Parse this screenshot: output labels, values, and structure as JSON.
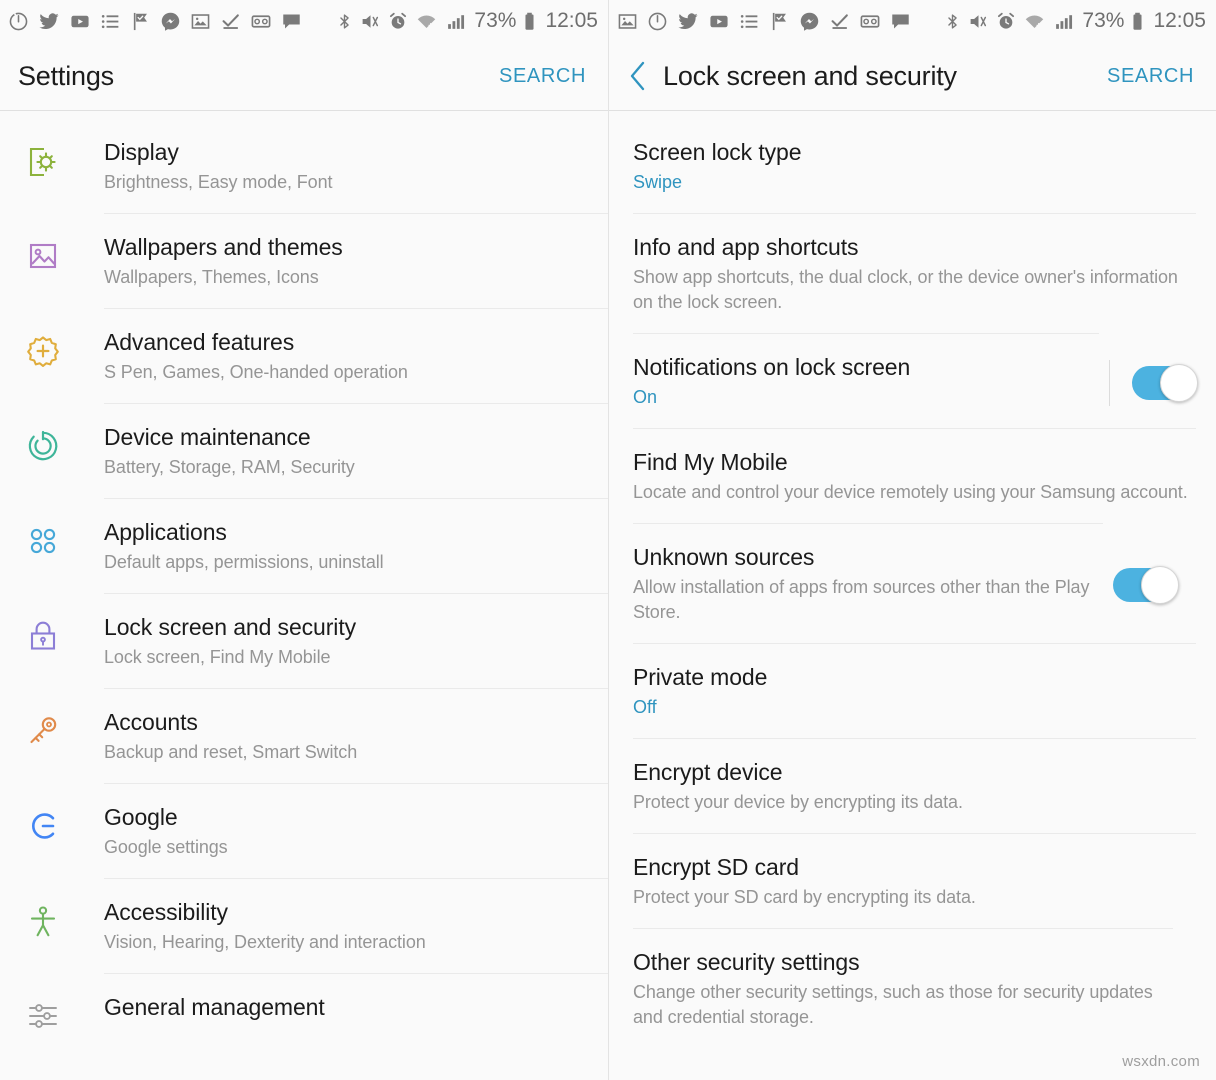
{
  "status_bar": {
    "left_notification_icons_panel1": [
      "power-clock-icon",
      "twitter-icon",
      "youtube-icon",
      "list-icon",
      "flag-check-icon",
      "messenger-icon",
      "image-icon",
      "checkmark-icon",
      "voicemail-icon",
      "chat-bubble-icon"
    ],
    "left_notification_icons_panel2": [
      "image-icon",
      "power-clock-icon",
      "twitter-icon",
      "youtube-icon",
      "list-icon",
      "flag-check-icon",
      "messenger-icon",
      "checkmark-icon",
      "voicemail-icon",
      "chat-bubble-icon"
    ],
    "system_icons": [
      "bluetooth-icon",
      "mute-icon",
      "alarm-icon",
      "wifi-icon",
      "signal-icon"
    ],
    "battery_percent": "73%",
    "clock": "12:05"
  },
  "left_panel": {
    "header": {
      "title": "Settings",
      "search_label": "SEARCH"
    },
    "items": [
      {
        "title": "Display",
        "subtitle": "Brightness, Easy mode, Font",
        "icon": "display-icon",
        "color": "#8cb23c"
      },
      {
        "title": "Wallpapers and themes",
        "subtitle": "Wallpapers, Themes, Icons",
        "icon": "wallpaper-icon",
        "color": "#b07cc6"
      },
      {
        "title": "Advanced features",
        "subtitle": "S Pen, Games, One-handed operation",
        "icon": "advanced-features-icon",
        "color": "#e0ad3c"
      },
      {
        "title": "Device maintenance",
        "subtitle": "Battery, Storage, RAM, Security",
        "icon": "device-maintenance-icon",
        "color": "#3eb599"
      },
      {
        "title": "Applications",
        "subtitle": "Default apps, permissions, uninstall",
        "icon": "applications-icon",
        "color": "#46a8d8"
      },
      {
        "title": "Lock screen and security",
        "subtitle": "Lock screen, Find My Mobile",
        "icon": "lock-icon",
        "color": "#8c7ed6"
      },
      {
        "title": "Accounts",
        "subtitle": "Backup and reset, Smart Switch",
        "icon": "key-icon",
        "color": "#e08a4a"
      },
      {
        "title": "Google",
        "subtitle": "Google settings",
        "icon": "google-icon",
        "color": "#4285f4"
      },
      {
        "title": "Accessibility",
        "subtitle": "Vision, Hearing, Dexterity and interaction",
        "icon": "accessibility-icon",
        "color": "#6fb45f"
      },
      {
        "title": "General management",
        "subtitle": "",
        "icon": "sliders-icon",
        "color": "#9e9e9e"
      }
    ]
  },
  "right_panel": {
    "header": {
      "back_icon": "chevron-left-icon",
      "title": "Lock screen and security",
      "search_label": "SEARCH"
    },
    "items": [
      {
        "title": "Screen lock type",
        "value": "Swipe",
        "subtitle": "",
        "toggle": null,
        "divider": false
      },
      {
        "title": "Info and app shortcuts",
        "value": "",
        "subtitle": "Show app shortcuts, the dual clock, or the device owner's information on the lock screen.",
        "toggle": null,
        "divider": false
      },
      {
        "title": "Notifications on lock screen",
        "value": "On",
        "subtitle": "",
        "toggle": "on",
        "divider": true
      },
      {
        "title": "Find My Mobile",
        "value": "",
        "subtitle": "Locate and control your device remotely using your Samsung account.",
        "toggle": null,
        "divider": false
      },
      {
        "title": "Unknown sources",
        "value": "",
        "subtitle": "Allow installation of apps from sources other than the Play Store.",
        "toggle": "on",
        "divider": false
      },
      {
        "title": "Private mode",
        "value": "Off",
        "subtitle": "",
        "toggle": null,
        "divider": false
      },
      {
        "title": "Encrypt device",
        "value": "",
        "subtitle": "Protect your device by encrypting its data.",
        "toggle": null,
        "divider": false
      },
      {
        "title": "Encrypt SD card",
        "value": "",
        "subtitle": "Protect your SD card by encrypting its data.",
        "toggle": null,
        "divider": false
      },
      {
        "title": "Other security settings",
        "value": "",
        "subtitle": "Change other security settings, such as those for security updates and credential storage.",
        "toggle": null,
        "divider": false
      }
    ]
  },
  "watermark": "wsxdn.com",
  "colors": {
    "accent": "#2f94bf",
    "toggle_on": "#4cb2e0",
    "title": "#1b1b1b",
    "subtitle": "#959595",
    "background": "#fafafa"
  }
}
